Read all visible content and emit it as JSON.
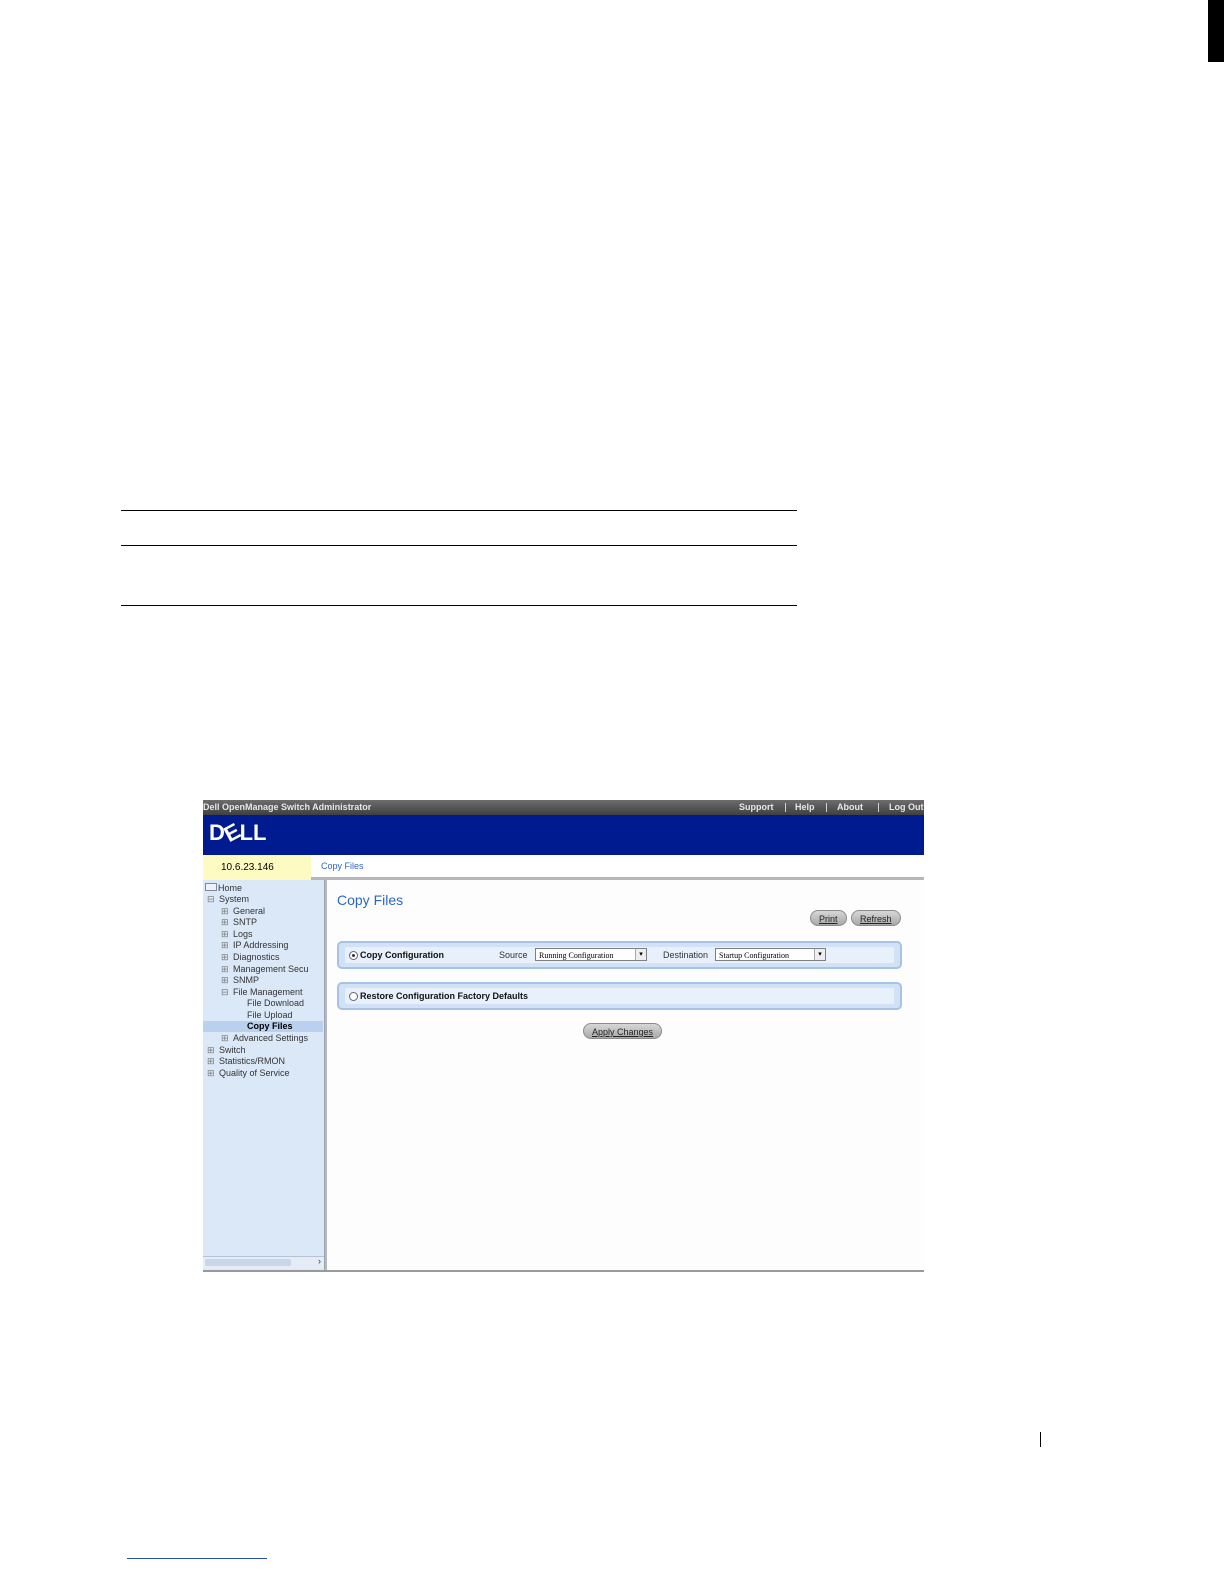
{
  "screenshot": {
    "app_title": "Dell OpenManage Switch Administrator",
    "top_links": [
      "Support",
      "Help",
      "About",
      "Log Out"
    ],
    "logo_text": [
      "D",
      "E",
      "LL"
    ],
    "ip_address": "10.6.23.146",
    "breadcrumb": "Copy Files",
    "nav": {
      "items": [
        {
          "label": "Home",
          "toggle": ""
        },
        {
          "label": "System",
          "toggle": "⊟"
        },
        {
          "label": "General",
          "toggle": "⊞"
        },
        {
          "label": "SNTP",
          "toggle": "⊞"
        },
        {
          "label": "Logs",
          "toggle": "⊞"
        },
        {
          "label": "IP Addressing",
          "toggle": "⊞"
        },
        {
          "label": "Diagnostics",
          "toggle": "⊞"
        },
        {
          "label": "Management Secu",
          "toggle": "⊞"
        },
        {
          "label": "SNMP",
          "toggle": "⊞"
        },
        {
          "label": "File Management",
          "toggle": "⊟"
        },
        {
          "label": "File Download",
          "toggle": ""
        },
        {
          "label": "File Upload",
          "toggle": ""
        },
        {
          "label": "Copy Files",
          "toggle": ""
        },
        {
          "label": "Advanced Settings",
          "toggle": "⊞"
        },
        {
          "label": "Switch",
          "toggle": "⊞"
        },
        {
          "label": "Statistics/RMON",
          "toggle": "⊞"
        },
        {
          "label": "Quality of Service",
          "toggle": "⊞"
        }
      ],
      "selected": "Copy Files",
      "scroll_arrow": "›"
    },
    "main": {
      "title": "Copy Files",
      "print_button": "Print",
      "refresh_button": "Refresh",
      "copy_config": {
        "label": "Copy Configuration",
        "selected": true,
        "source_label": "Source",
        "source_value": "Running Configuration",
        "destination_label": "Destination",
        "destination_value": "Startup Configuration"
      },
      "restore_defaults": {
        "label": "Restore Configuration Factory Defaults",
        "selected": false
      },
      "apply_button": "Apply Changes"
    }
  }
}
